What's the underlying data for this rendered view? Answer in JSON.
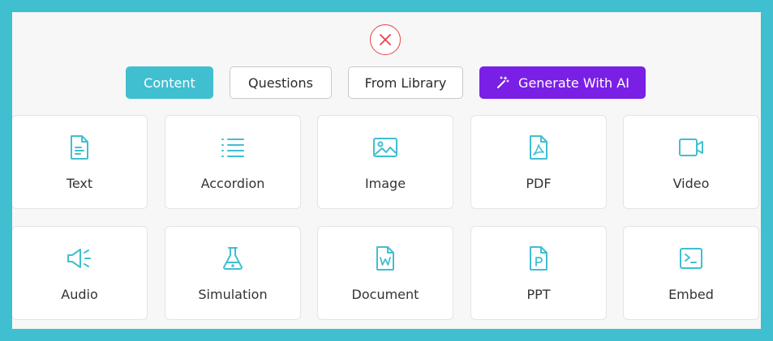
{
  "tabs": [
    {
      "label": "Content"
    },
    {
      "label": "Questions"
    },
    {
      "label": "From Library"
    },
    {
      "label": "Generate With AI"
    }
  ],
  "cards": [
    {
      "label": "Text",
      "icon": "text-file-icon"
    },
    {
      "label": "Accordion",
      "icon": "list-icon"
    },
    {
      "label": "Image",
      "icon": "image-icon"
    },
    {
      "label": "PDF",
      "icon": "pdf-file-icon"
    },
    {
      "label": "Video",
      "icon": "video-camera-icon"
    },
    {
      "label": "Audio",
      "icon": "speaker-icon"
    },
    {
      "label": "Simulation",
      "icon": "flask-icon"
    },
    {
      "label": "Document",
      "icon": "word-document-icon"
    },
    {
      "label": "PPT",
      "icon": "powerpoint-file-icon"
    },
    {
      "label": "Embed",
      "icon": "terminal-icon"
    }
  ],
  "colors": {
    "accent": "#40bfd1",
    "ai": "#7a1fe6",
    "close": "#e8424b"
  }
}
